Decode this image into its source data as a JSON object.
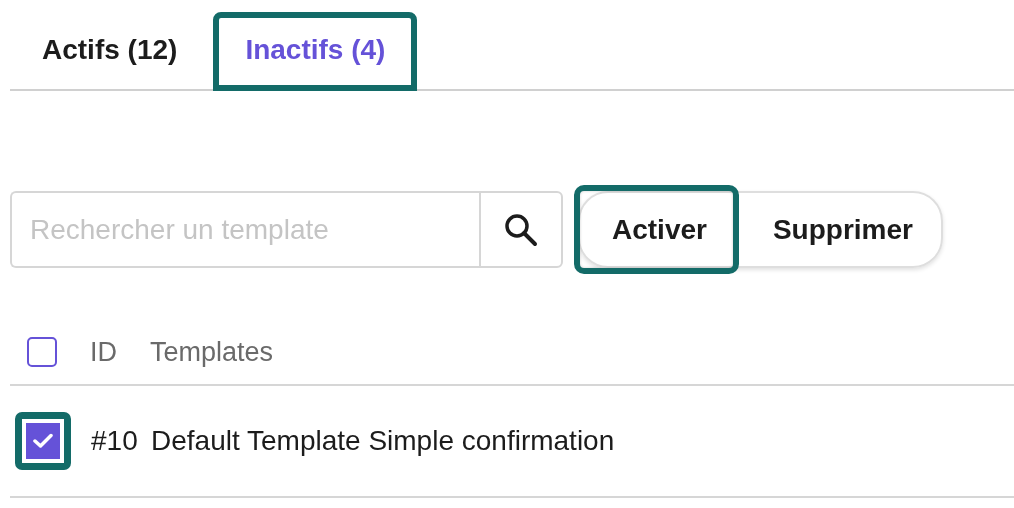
{
  "tabs": [
    {
      "label": "Actifs (12)",
      "selected": false,
      "highlighted": false
    },
    {
      "label": "Inactifs (4)",
      "selected": true,
      "highlighted": true
    }
  ],
  "search": {
    "placeholder": "Rechercher un template"
  },
  "actions": [
    {
      "label": "Activer",
      "highlighted": true
    },
    {
      "label": "Supprimer",
      "highlighted": false
    }
  ],
  "table": {
    "select_all": {
      "checked": false,
      "highlighted": false
    },
    "columns": [
      "ID",
      "Templates"
    ],
    "rows": [
      {
        "checked": true,
        "highlighted": true,
        "id": "#10",
        "name": "Default Template Simple confirmation"
      }
    ]
  }
}
